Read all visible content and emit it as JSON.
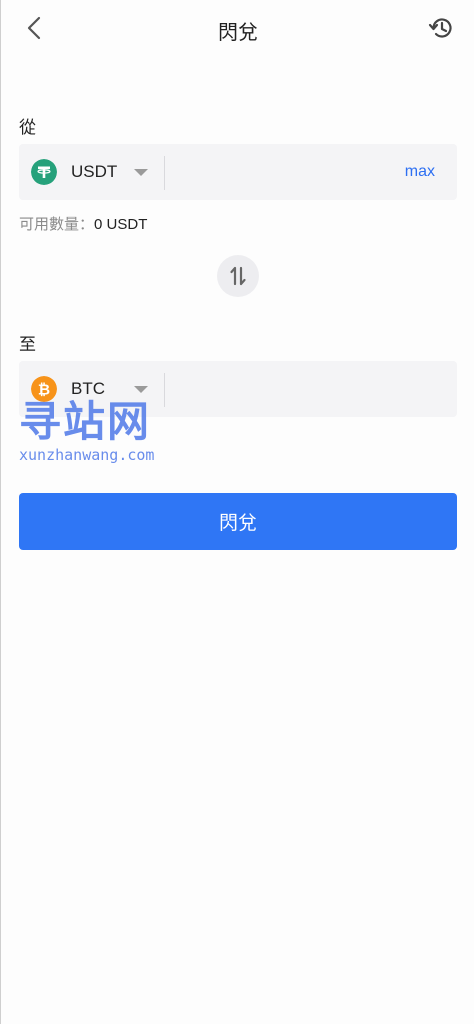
{
  "header": {
    "title": "閃兌",
    "back_icon": "chevron-left-icon",
    "history_icon": "history-icon"
  },
  "from": {
    "label": "從",
    "coin": "USDT",
    "coin_icon": "tether-icon",
    "coin_color": "#26a17b",
    "amount_placeholder": "",
    "max_label": "max"
  },
  "available": {
    "label": "可用數量：",
    "value": "0 USDT"
  },
  "swap_icon": "swap-vertical-icon",
  "to": {
    "label": "至",
    "coin": "BTC",
    "coin_icon": "bitcoin-icon",
    "coin_color": "#f7931a",
    "amount_placeholder": ""
  },
  "watermark": {
    "title": "寻站网",
    "url": "xunzhanwang.com"
  },
  "submit_label": "閃兌",
  "colors": {
    "accent": "#2f76f5",
    "link": "#2d6ff2"
  }
}
